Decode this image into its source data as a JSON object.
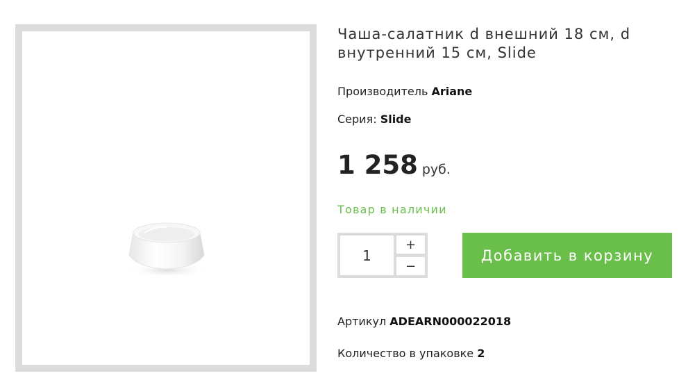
{
  "product": {
    "title": "Чаша-салатник d внешний 18 см, d внутренний 15 см, Slide",
    "manufacturer_label": "Производитель",
    "manufacturer_value": "Ariane",
    "series_label": "Серия:",
    "series_value": "Slide",
    "price_value": "1 258",
    "price_currency": "руб.",
    "stock_status": "Товар в наличии",
    "sku_label": "Артикул",
    "sku_value": "ADEARN000022018",
    "pack_label": "Количество в упаковке",
    "pack_value": "2"
  },
  "quantity": {
    "value": "1",
    "plus_label": "+",
    "minus_label": "−"
  },
  "cart": {
    "add_label": "Добавить в корзину"
  },
  "colors": {
    "accent_green": "#6abf4b",
    "frame_gray": "#dcdcdc"
  }
}
